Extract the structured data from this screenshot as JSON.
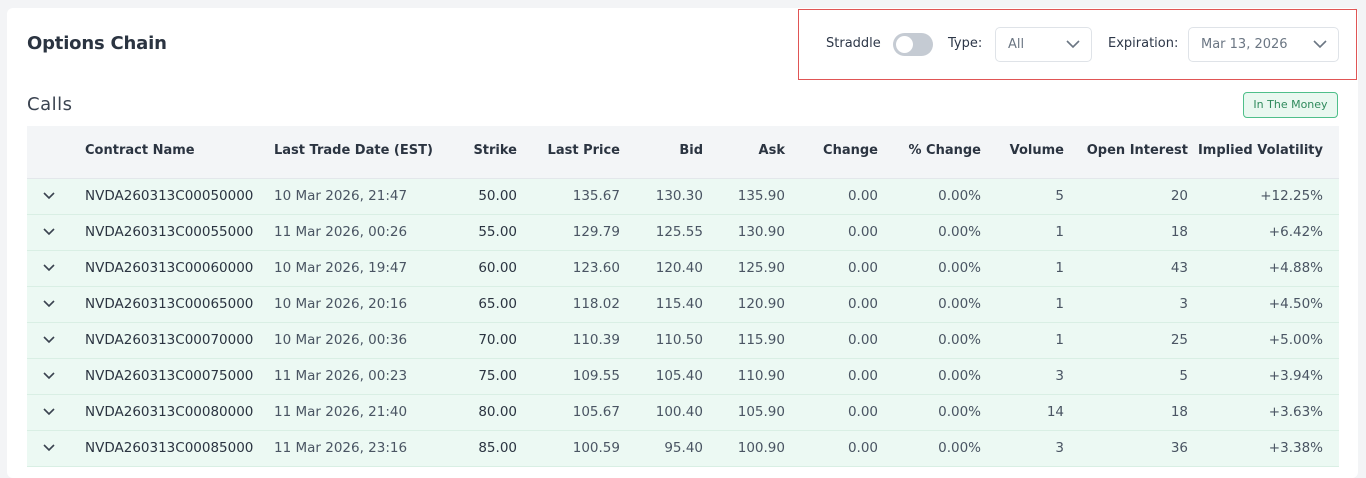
{
  "header": {
    "title": "Options Chain"
  },
  "controls": {
    "straddle_label": "Straddle",
    "straddle_on": false,
    "type_label": "Type:",
    "type_value": "All",
    "expiration_label": "Expiration:",
    "expiration_value": "Mar 13, 2026",
    "highlight_color": "#e05555"
  },
  "section": {
    "title": "Calls",
    "badge": "In The Money",
    "itm_color": "#ecf9f3"
  },
  "table": {
    "columns": [
      "Contract Name",
      "Last Trade Date (EST)",
      "Strike",
      "Last Price",
      "Bid",
      "Ask",
      "Change",
      "% Change",
      "Volume",
      "Open Interest",
      "Implied Volatility"
    ],
    "rows": [
      [
        "NVDA260313C00050000",
        "10 Mar 2026, 21:47",
        "50.00",
        "135.67",
        "130.30",
        "135.90",
        "0.00",
        "0.00%",
        "5",
        "20",
        "+12.25%"
      ],
      [
        "NVDA260313C00055000",
        "11 Mar 2026, 00:26",
        "55.00",
        "129.79",
        "125.55",
        "130.90",
        "0.00",
        "0.00%",
        "1",
        "18",
        "+6.42%"
      ],
      [
        "NVDA260313C00060000",
        "10 Mar 2026, 19:47",
        "60.00",
        "123.60",
        "120.40",
        "125.90",
        "0.00",
        "0.00%",
        "1",
        "43",
        "+4.88%"
      ],
      [
        "NVDA260313C00065000",
        "10 Mar 2026, 20:16",
        "65.00",
        "118.02",
        "115.40",
        "120.90",
        "0.00",
        "0.00%",
        "1",
        "3",
        "+4.50%"
      ],
      [
        "NVDA260313C00070000",
        "10 Mar 2026, 00:36",
        "70.00",
        "110.39",
        "110.50",
        "115.90",
        "0.00",
        "0.00%",
        "1",
        "25",
        "+5.00%"
      ],
      [
        "NVDA260313C00075000",
        "11 Mar 2026, 00:23",
        "75.00",
        "109.55",
        "105.40",
        "110.90",
        "0.00",
        "0.00%",
        "3",
        "5",
        "+3.94%"
      ],
      [
        "NVDA260313C00080000",
        "11 Mar 2026, 21:40",
        "80.00",
        "105.67",
        "100.40",
        "105.90",
        "0.00",
        "0.00%",
        "14",
        "18",
        "+3.63%"
      ],
      [
        "NVDA260313C00085000",
        "11 Mar 2026, 23:16",
        "85.00",
        "100.59",
        "95.40",
        "100.90",
        "0.00",
        "0.00%",
        "3",
        "36",
        "+3.38%"
      ]
    ]
  },
  "icons": {
    "expand": "chevron-down-icon",
    "dropdown": "chevron-down-icon"
  }
}
